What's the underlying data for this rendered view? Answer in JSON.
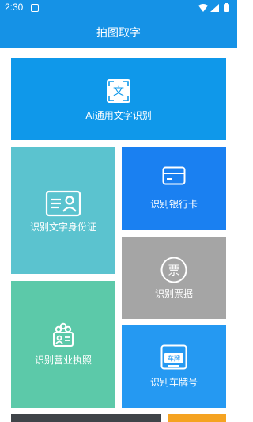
{
  "status_bar": {
    "time": "2:30",
    "icons": [
      "notification-icon",
      "wifi-icon",
      "signal-icon",
      "battery-icon"
    ]
  },
  "app_bar": {
    "title": "拍图取字"
  },
  "tiles": {
    "general": {
      "label": "Ai通用文字识别",
      "icon": "text-recognition-icon",
      "icon_text": "文",
      "color": "#0f98ea"
    },
    "idcard": {
      "label": "识别文字身份证",
      "icon": "id-card-icon",
      "color": "#5bc3cf"
    },
    "bank": {
      "label": "识别银行卡",
      "icon": "bank-card-icon",
      "color": "#1a80f1"
    },
    "receipt": {
      "label": "识别票据",
      "icon": "receipt-icon",
      "icon_text": "票",
      "color": "#a5a5a5"
    },
    "license": {
      "label": "识别营业执照",
      "icon": "business-license-icon",
      "color": "#5cc9a9"
    },
    "plate": {
      "label": "识别车牌号",
      "icon": "license-plate-icon",
      "icon_text": "车牌",
      "color": "#2599f2"
    }
  },
  "colors": {
    "accent": "#1592e6",
    "bottom_dark": "#3f4449",
    "bottom_orange": "#f5a321"
  }
}
